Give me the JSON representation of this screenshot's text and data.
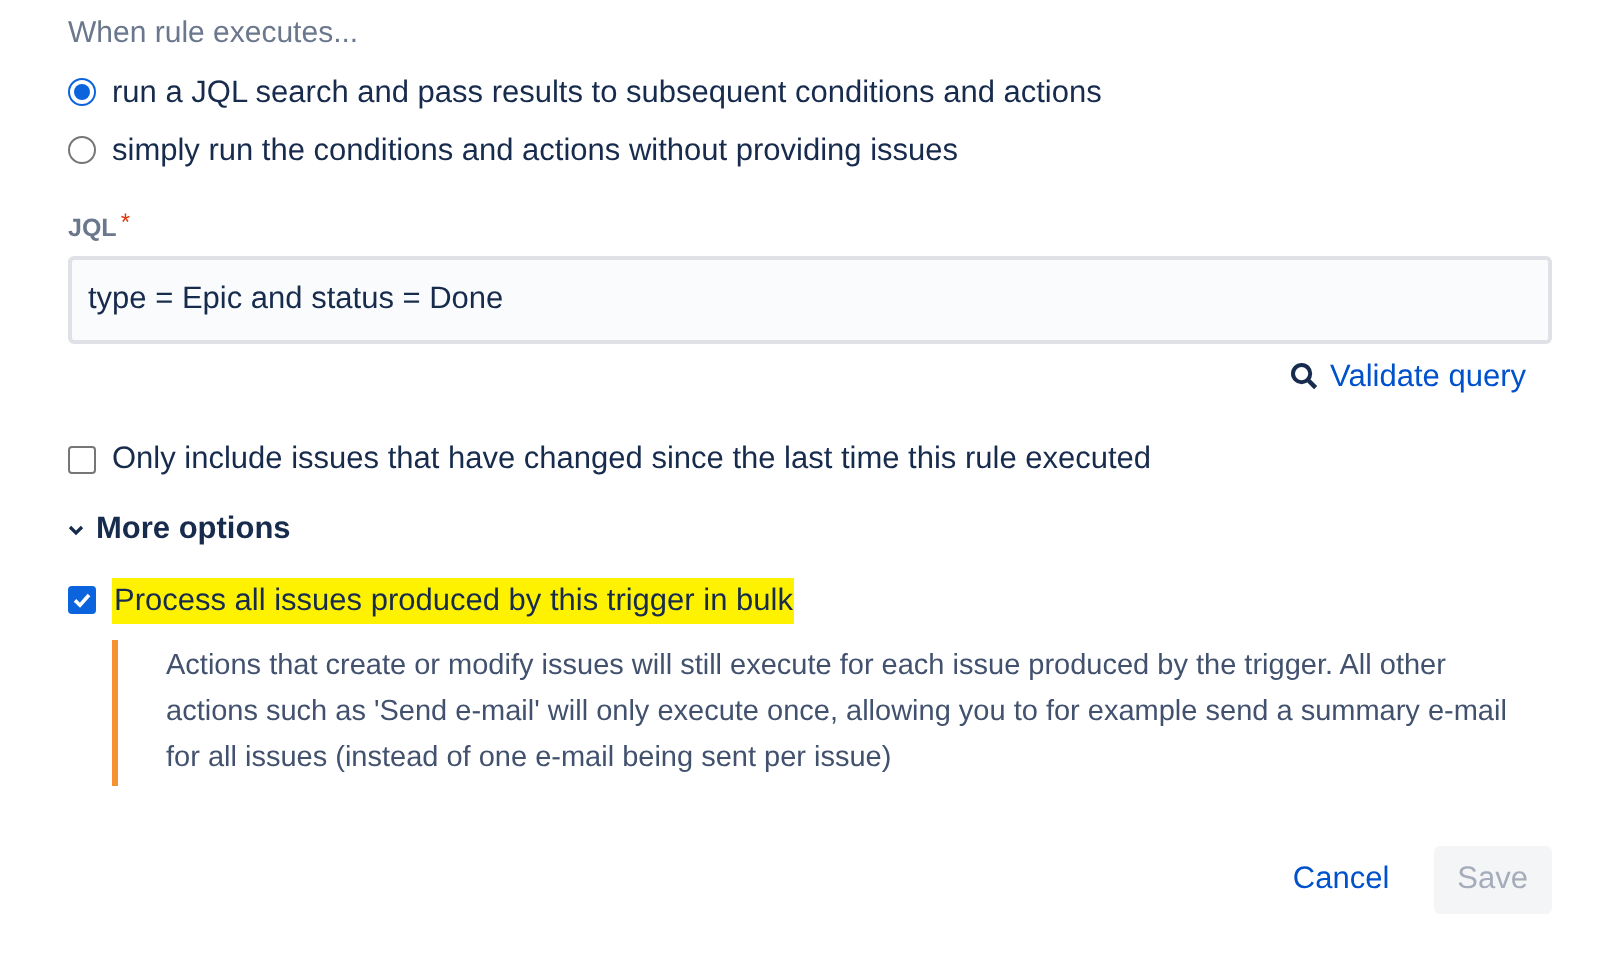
{
  "section_heading": "When rule executes...",
  "radios": [
    {
      "label": "run a JQL search and pass results to subsequent conditions and actions",
      "selected": true
    },
    {
      "label": "simply run the conditions and actions without providing issues",
      "selected": false
    }
  ],
  "jql": {
    "label": "JQL",
    "required_marker": "*",
    "value": "type = Epic and status = Done"
  },
  "validate_link": "Validate query",
  "changed_checkbox": {
    "label": "Only include issues that have changed since the last time this rule executed",
    "checked": false
  },
  "more_options": {
    "label": "More options",
    "expanded": true
  },
  "bulk_checkbox": {
    "label": "Process all issues produced by this trigger in bulk",
    "checked": true,
    "highlighted": true
  },
  "note": "Actions that create or modify issues will still execute for each issue produced by the trigger. All other actions such as 'Send e-mail' will only execute once, allowing you to for example send a summary e-mail for all issues (instead of one e-mail being sent per issue)",
  "buttons": [
    {
      "label": "Cancel",
      "kind": "link",
      "disabled": false
    },
    {
      "label": "Save",
      "kind": "primary",
      "disabled": true
    }
  ]
}
